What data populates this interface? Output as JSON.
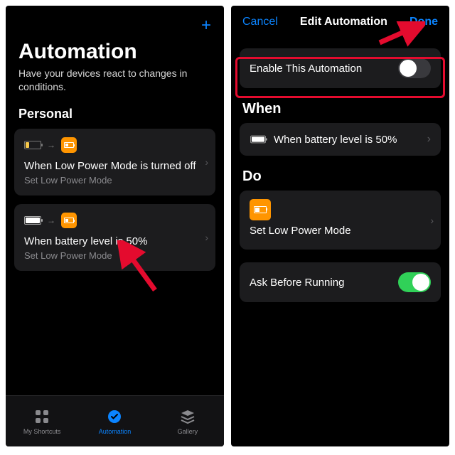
{
  "left": {
    "add_label": "+",
    "title": "Automation",
    "subtitle": "Have your devices react to changes in conditions.",
    "section": "Personal",
    "automations": [
      {
        "title": "When Low Power Mode is turned off",
        "subtitle": "Set Low Power Mode"
      },
      {
        "title": "When battery level is 50%",
        "subtitle": "Set Low Power Mode"
      }
    ],
    "tabs": {
      "shortcuts": "My Shortcuts",
      "automation": "Automation",
      "gallery": "Gallery"
    }
  },
  "right": {
    "nav": {
      "cancel": "Cancel",
      "title": "Edit Automation",
      "done": "Done"
    },
    "enable_label": "Enable This Automation",
    "enable_on": false,
    "when_header": "When",
    "when_text": "When battery level is 50%",
    "do_header": "Do",
    "do_action": "Set Low Power Mode",
    "ask_label": "Ask Before Running",
    "ask_on": true
  }
}
